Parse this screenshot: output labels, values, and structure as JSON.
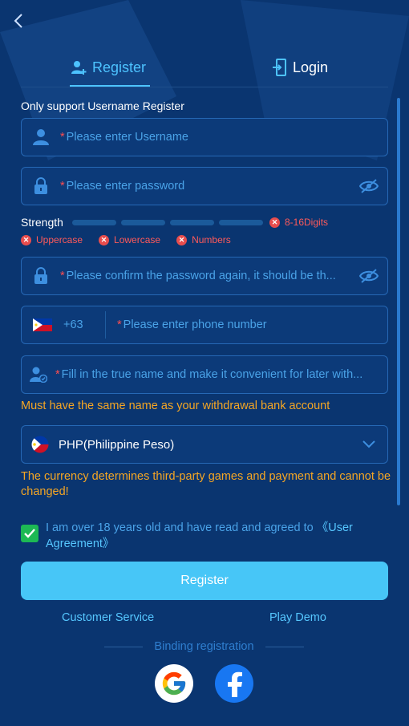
{
  "tabs": [
    {
      "label": "Register",
      "icon": "add-user-icon",
      "active": true
    },
    {
      "label": "Login",
      "icon": "login-icon",
      "active": false
    }
  ],
  "form": {
    "section_title": "Only support Username Register",
    "required_mark": "*",
    "username_placeholder": "Please enter Username",
    "password_placeholder": "Please enter password",
    "strength_label": "Strength",
    "strength_bars": 4,
    "requirements": {
      "length": "8-16Digits",
      "uppercase": "Uppercase",
      "lowercase": "Lowercase",
      "numbers": "Numbers"
    },
    "confirm_placeholder": "Please confirm the password again, it should be th...",
    "phone_code": "+63",
    "phone_placeholder": "Please enter phone number",
    "realname_placeholder": "Fill in the true name and make it convenient for later with...",
    "realname_note": "Must have the same name as your withdrawal bank account",
    "currency_value": "PHP(Philippine Peso)",
    "currency_note": "The currency determines third-party games and payment and cannot be changed!",
    "agree_text": "I am over 18 years old and have read and agreed to ",
    "agree_link": "《User Agreement》",
    "agree_checked": true,
    "submit_label": "Register"
  },
  "links": {
    "customer_service": "Customer Service",
    "play_demo": "Play Demo",
    "binding": "Binding registration"
  },
  "social": [
    "google-icon",
    "facebook-icon"
  ],
  "colors": {
    "background": "#0a3570",
    "accent": "#4dc3ff",
    "placeholder": "#4aa3e8",
    "warning": "#f5a623",
    "error": "#ff5a5a",
    "button": "#47c6f7",
    "checkbox": "#1db954"
  }
}
